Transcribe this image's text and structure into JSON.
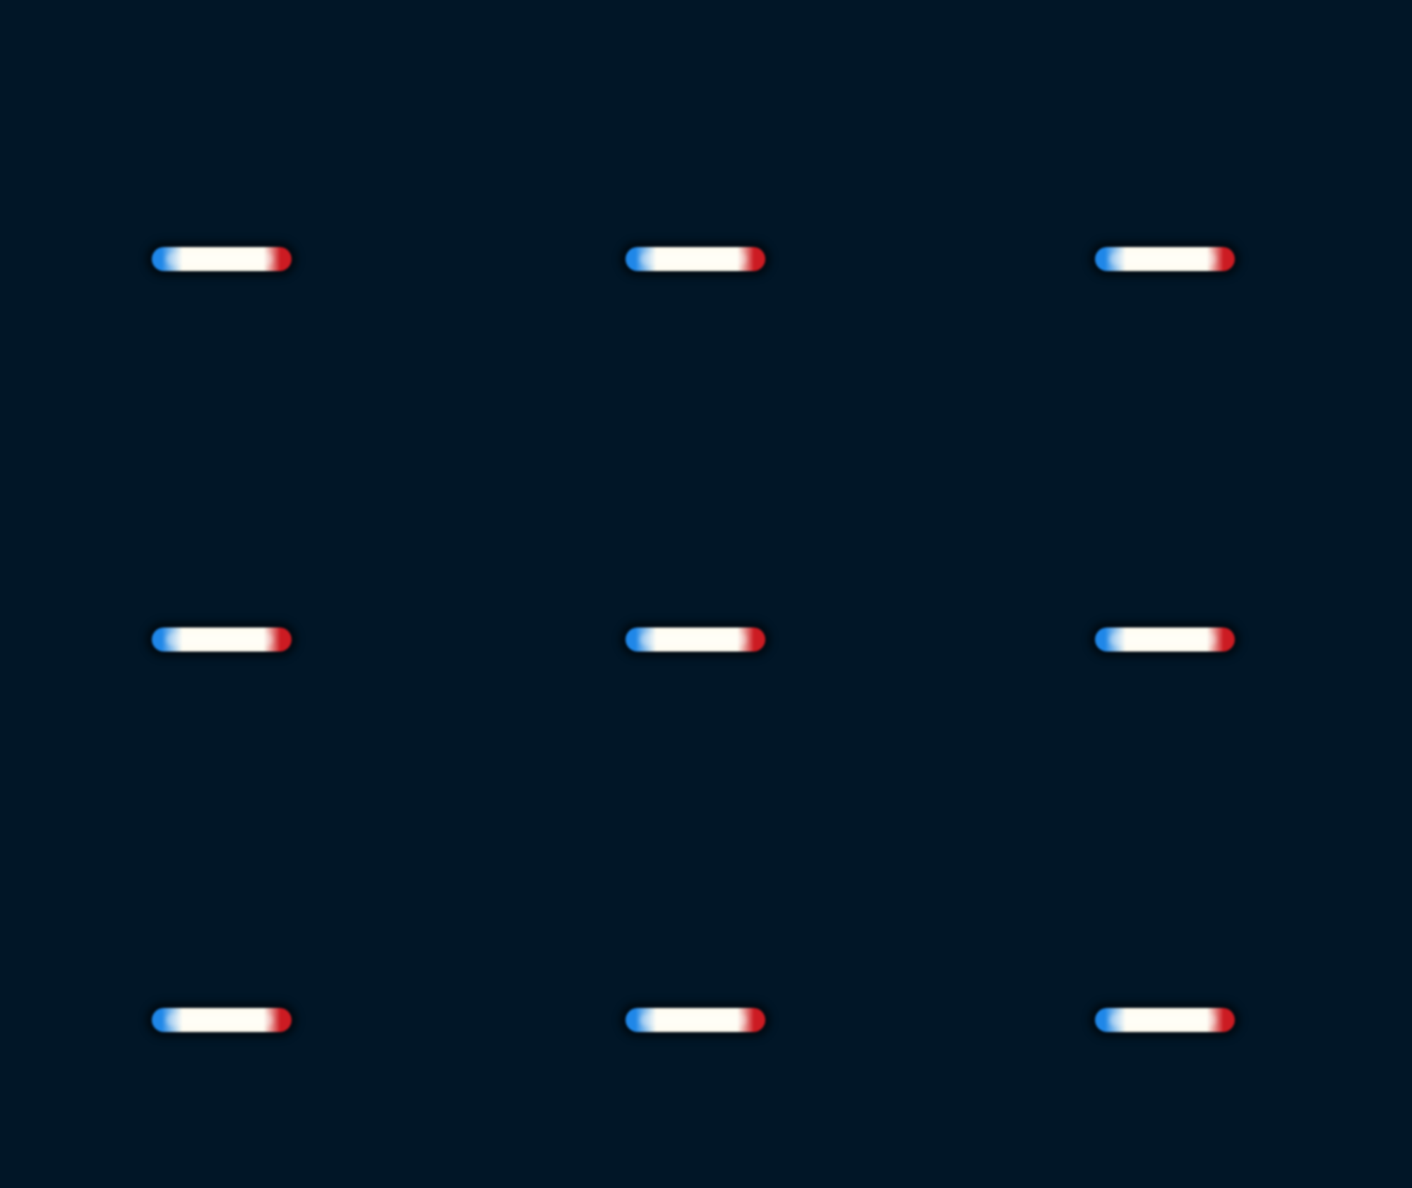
{
  "colors": {
    "background": "#011627",
    "dash_left": "#1f87e8",
    "dash_center": "#fffdf2",
    "dash_right": "#cc1b22",
    "shadow": "#000000"
  },
  "grid": {
    "rows": 3,
    "columns": 3
  },
  "icons": [
    "dash-icon",
    "dash-icon",
    "dash-icon",
    "dash-icon",
    "dash-icon",
    "dash-icon",
    "dash-icon",
    "dash-icon",
    "dash-icon"
  ]
}
